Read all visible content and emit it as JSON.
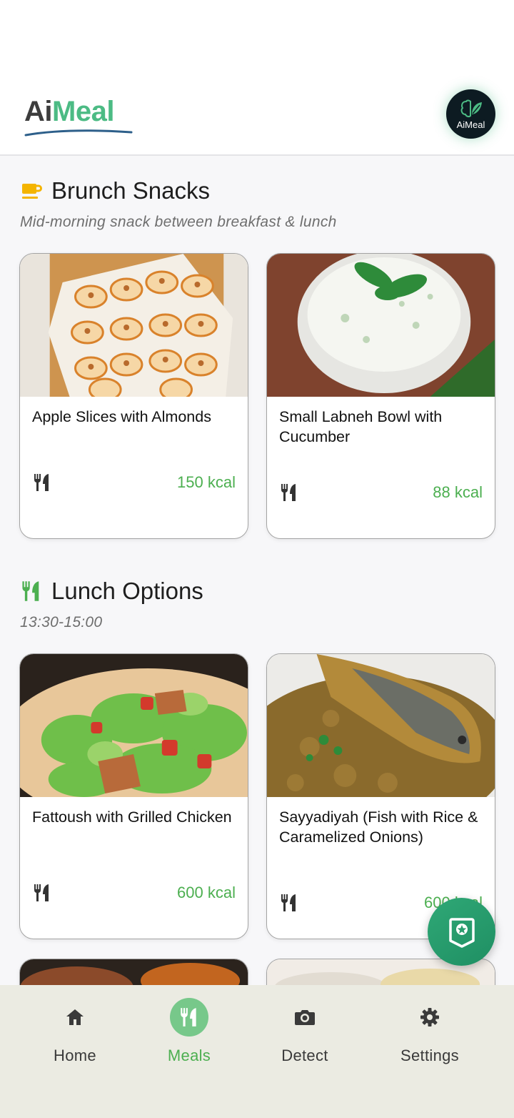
{
  "header": {
    "logo_ai": "Ai",
    "logo_meal": "Meal",
    "avatar_label": "AiMeal"
  },
  "sections": [
    {
      "title": "Brunch Snacks",
      "subtitle": "Mid-morning snack between breakfast & lunch",
      "icon": "coffee-cup-icon",
      "icon_color": "#f4b400",
      "cards": [
        {
          "name": "Apple Slices with Almonds",
          "kcal": "150 kcal",
          "image": "apple-slices-photo"
        },
        {
          "name": "Small Labneh Bowl with Cucumber",
          "kcal": "88 kcal",
          "image": "labneh-bowl-photo"
        }
      ]
    },
    {
      "title": "Lunch Options",
      "subtitle": "13:30-15:00",
      "icon": "fork-knife-icon",
      "icon_color": "#4caf50",
      "cards": [
        {
          "name": "Fattoush with Grilled Chicken",
          "kcal": "600 kcal",
          "image": "fattoush-photo"
        },
        {
          "name": "Sayyadiyah (Fish with Rice & Caramelized Onions)",
          "kcal": "600 kcal",
          "image": "sayyadiyah-photo"
        }
      ]
    }
  ],
  "nav": {
    "items": [
      {
        "label": "Home",
        "icon": "home-icon",
        "active": false
      },
      {
        "label": "Meals",
        "icon": "fork-knife-icon",
        "active": true
      },
      {
        "label": "Detect",
        "icon": "camera-icon",
        "active": false
      },
      {
        "label": "Settings",
        "icon": "gear-icon",
        "active": false
      }
    ]
  },
  "fab": {
    "icon": "award-ribbon-icon"
  },
  "colors": {
    "accent": "#4caf50",
    "brand": "#4cbb84",
    "nav_bg": "#ebebe2",
    "fab": "#2a9d6e"
  }
}
